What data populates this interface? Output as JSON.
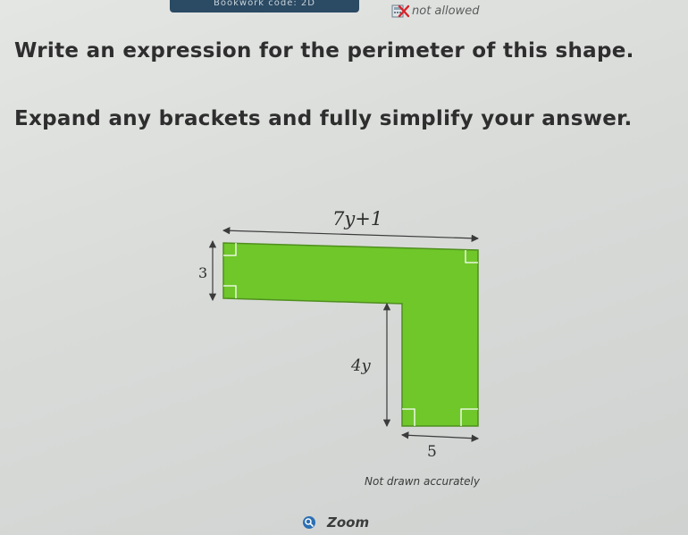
{
  "header": {
    "badge_text": "Bookwork code: 2D",
    "calculator_label": "not allowed"
  },
  "question": {
    "line1": "Write an expression for the perimeter of this shape.",
    "line2": "Expand any brackets and fully simplify your answer."
  },
  "diagram": {
    "fill_color": "#6fc72a",
    "labels": {
      "top": "7y+1",
      "left": "3",
      "inner": "4y",
      "bottom": "5"
    },
    "note": "Not drawn accurately"
  },
  "zoom": {
    "label": "Zoom",
    "icon": "magnifier-icon"
  }
}
